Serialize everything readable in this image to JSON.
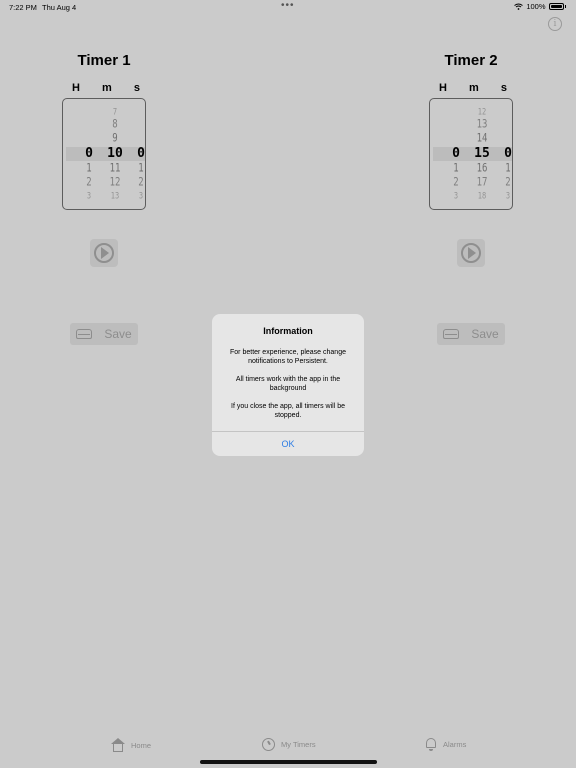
{
  "status_bar": {
    "time": "7:22 PM",
    "date": "Thu Aug 4",
    "dots": "•••",
    "battery": "100%",
    "wifi_icon": "wifi-icon",
    "battery_icon": "battery-icon"
  },
  "header": {
    "info_icon": "i"
  },
  "timers": [
    {
      "title": "Timer 1",
      "units": [
        "H",
        "m",
        "s"
      ],
      "columns": [
        {
          "rows": [
            "",
            "",
            "",
            "0",
            "1",
            "2",
            "3"
          ]
        },
        {
          "rows": [
            "7",
            "8",
            "9",
            "10",
            "11",
            "12",
            "13"
          ]
        },
        {
          "rows": [
            "",
            "",
            "",
            "0",
            "1",
            "2",
            "3"
          ]
        }
      ],
      "save_label": "Save"
    },
    {
      "title": "Timer 2",
      "units": [
        "H",
        "m",
        "s"
      ],
      "columns": [
        {
          "rows": [
            "",
            "",
            "",
            "0",
            "1",
            "2",
            "3"
          ]
        },
        {
          "rows": [
            "12",
            "13",
            "14",
            "15",
            "16",
            "17",
            "18"
          ]
        },
        {
          "rows": [
            "",
            "",
            "",
            "0",
            "1",
            "2",
            "3"
          ]
        }
      ],
      "save_label": "Save"
    }
  ],
  "alert": {
    "title": "Information",
    "messages": [
      "For better experience, please change notifications to Persistent.",
      "All timers work with the app in the background",
      "If you close the app, all timers will be stopped."
    ],
    "ok_label": "OK",
    "ok_color": "#2c7ce4"
  },
  "tabbar": {
    "home": "Home",
    "my_timers": "My Timers",
    "alarms": "Alarms"
  }
}
